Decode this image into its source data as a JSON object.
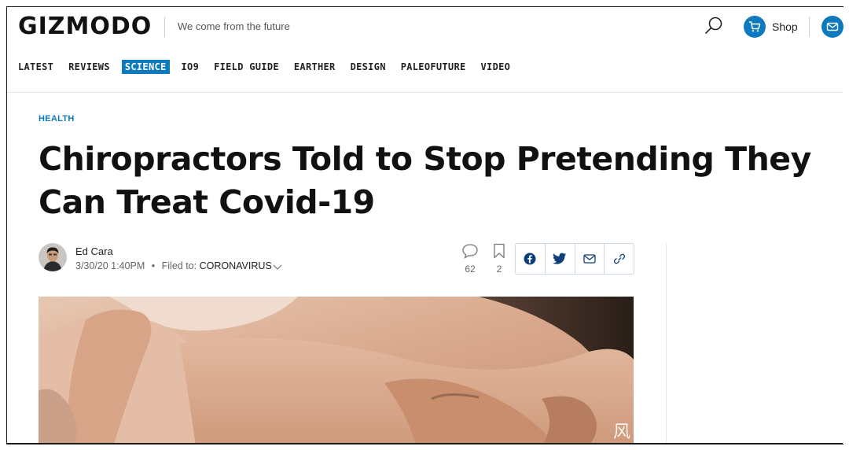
{
  "header": {
    "logo": "GIZMODO",
    "tagline": "We come from the future",
    "shop_label": "Shop",
    "icons": {
      "search": "search-icon",
      "shop": "cart-icon",
      "mail": "envelope-icon"
    },
    "accent_color": "#0d7abf"
  },
  "nav": {
    "items": [
      {
        "label": "LATEST",
        "active": false
      },
      {
        "label": "REVIEWS",
        "active": false
      },
      {
        "label": "SCIENCE",
        "active": true
      },
      {
        "label": "IO9",
        "active": false
      },
      {
        "label": "FIELD GUIDE",
        "active": false
      },
      {
        "label": "EARTHER",
        "active": false
      },
      {
        "label": "DESIGN",
        "active": false
      },
      {
        "label": "PALEOFUTURE",
        "active": false
      },
      {
        "label": "VIDEO",
        "active": false
      }
    ]
  },
  "article": {
    "category": "HEALTH",
    "headline": "Chiropractors Told to Stop Pretending They Can Treat Covid-19",
    "author": "Ed Cara",
    "timestamp": "3/30/20 1:40PM",
    "separator": "•",
    "filed_label": "Filed to:",
    "filed_tag": "CORONAVIRUS",
    "comments_count": "62",
    "bookmarks_count": "2",
    "share_icons": [
      "facebook-icon",
      "twitter-icon",
      "email-icon",
      "link-icon"
    ],
    "image_watermark": "风"
  }
}
